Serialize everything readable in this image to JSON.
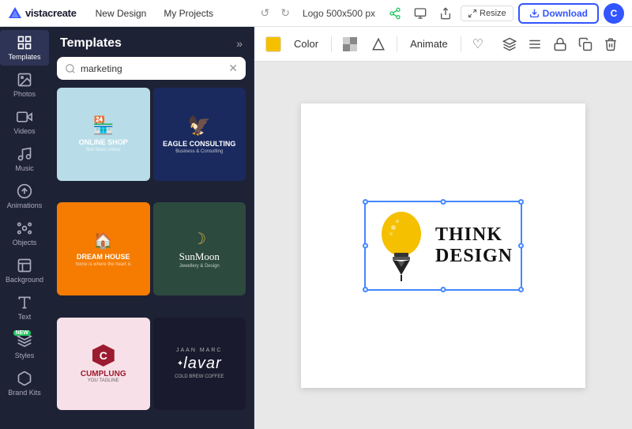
{
  "header": {
    "logo_text": "vistacreate",
    "nav_items": [
      "New Design",
      "My Projects"
    ],
    "canvas_label": "Logo 500x500 px",
    "resize_label": "Resize",
    "download_label": "Download",
    "avatar_initial": "C"
  },
  "sidebar": {
    "items": [
      {
        "label": "Templates",
        "icon": "grid-icon",
        "active": true
      },
      {
        "label": "Photos",
        "icon": "photo-icon",
        "active": false
      },
      {
        "label": "Videos",
        "icon": "video-icon",
        "active": false
      },
      {
        "label": "Music",
        "icon": "music-icon",
        "active": false
      },
      {
        "label": "Animations",
        "icon": "animation-icon",
        "active": false
      },
      {
        "label": "Objects",
        "icon": "objects-icon",
        "active": false
      },
      {
        "label": "Background",
        "icon": "background-icon",
        "active": false
      },
      {
        "label": "Text",
        "icon": "text-icon",
        "active": false
      },
      {
        "label": "Styles",
        "icon": "styles-icon",
        "active": false,
        "badge": "NEW"
      },
      {
        "label": "Brand Kits",
        "icon": "brand-icon",
        "active": false
      }
    ]
  },
  "templates_panel": {
    "title": "Templates",
    "search_placeholder": "marketing",
    "search_value": "marketing",
    "templates": [
      {
        "id": 1,
        "name": "Online Shop",
        "subtitle": "Find deals online",
        "bg": "#b8dde8"
      },
      {
        "id": 2,
        "name": "Eagle Consulting",
        "subtitle": "Business & Consulting",
        "bg": "#1a2a5e"
      },
      {
        "id": 3,
        "name": "Dream House",
        "subtitle": "Home is where the heart is",
        "bg": "#f57c00"
      },
      {
        "id": 4,
        "name": "SunMoon",
        "subtitle": "Jewellery & Design",
        "bg": "#2d4a3e"
      },
      {
        "id": 5,
        "name": "Cumplung",
        "subtitle": "Your tagline",
        "bg": "#f8e0e8"
      },
      {
        "id": 6,
        "name": "lavar",
        "subtitle": "Cold brew coffee",
        "bg": "#1a1a2e"
      }
    ]
  },
  "canvas": {
    "toolbar": {
      "color_label": "Color",
      "animate_label": "Animate"
    },
    "design": {
      "text_line1": "THINK",
      "text_line2": "DESIGN"
    }
  }
}
